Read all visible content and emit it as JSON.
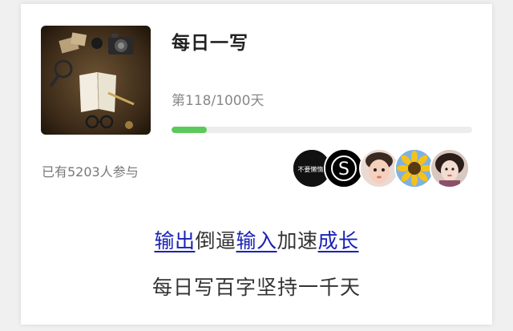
{
  "card": {
    "title": "每日一写",
    "progress_text": "第118/1000天",
    "progress": {
      "current": 118,
      "total": 1000
    },
    "participants_text": "已有5203人参与",
    "cover_image": "vintage-desk-with-camera-notebook-glasses",
    "avatars": [
      {
        "name": "avatar-text-badge",
        "caption": "不要懒惰!"
      },
      {
        "name": "avatar-letter-s",
        "caption": "S"
      },
      {
        "name": "avatar-child-photo"
      },
      {
        "name": "avatar-sunflower"
      },
      {
        "name": "avatar-girl-photo"
      }
    ]
  },
  "slogan": {
    "line1": [
      {
        "text": "输出",
        "link": true
      },
      {
        "text": "倒逼",
        "link": false
      },
      {
        "text": "输入",
        "link": true
      },
      {
        "text": "加速",
        "link": false
      },
      {
        "text": "成长",
        "link": true
      }
    ],
    "line2": "每日写百字坚持一千天"
  },
  "colors": {
    "accent_progress": "#5bc95b",
    "link": "#1a22b5"
  }
}
